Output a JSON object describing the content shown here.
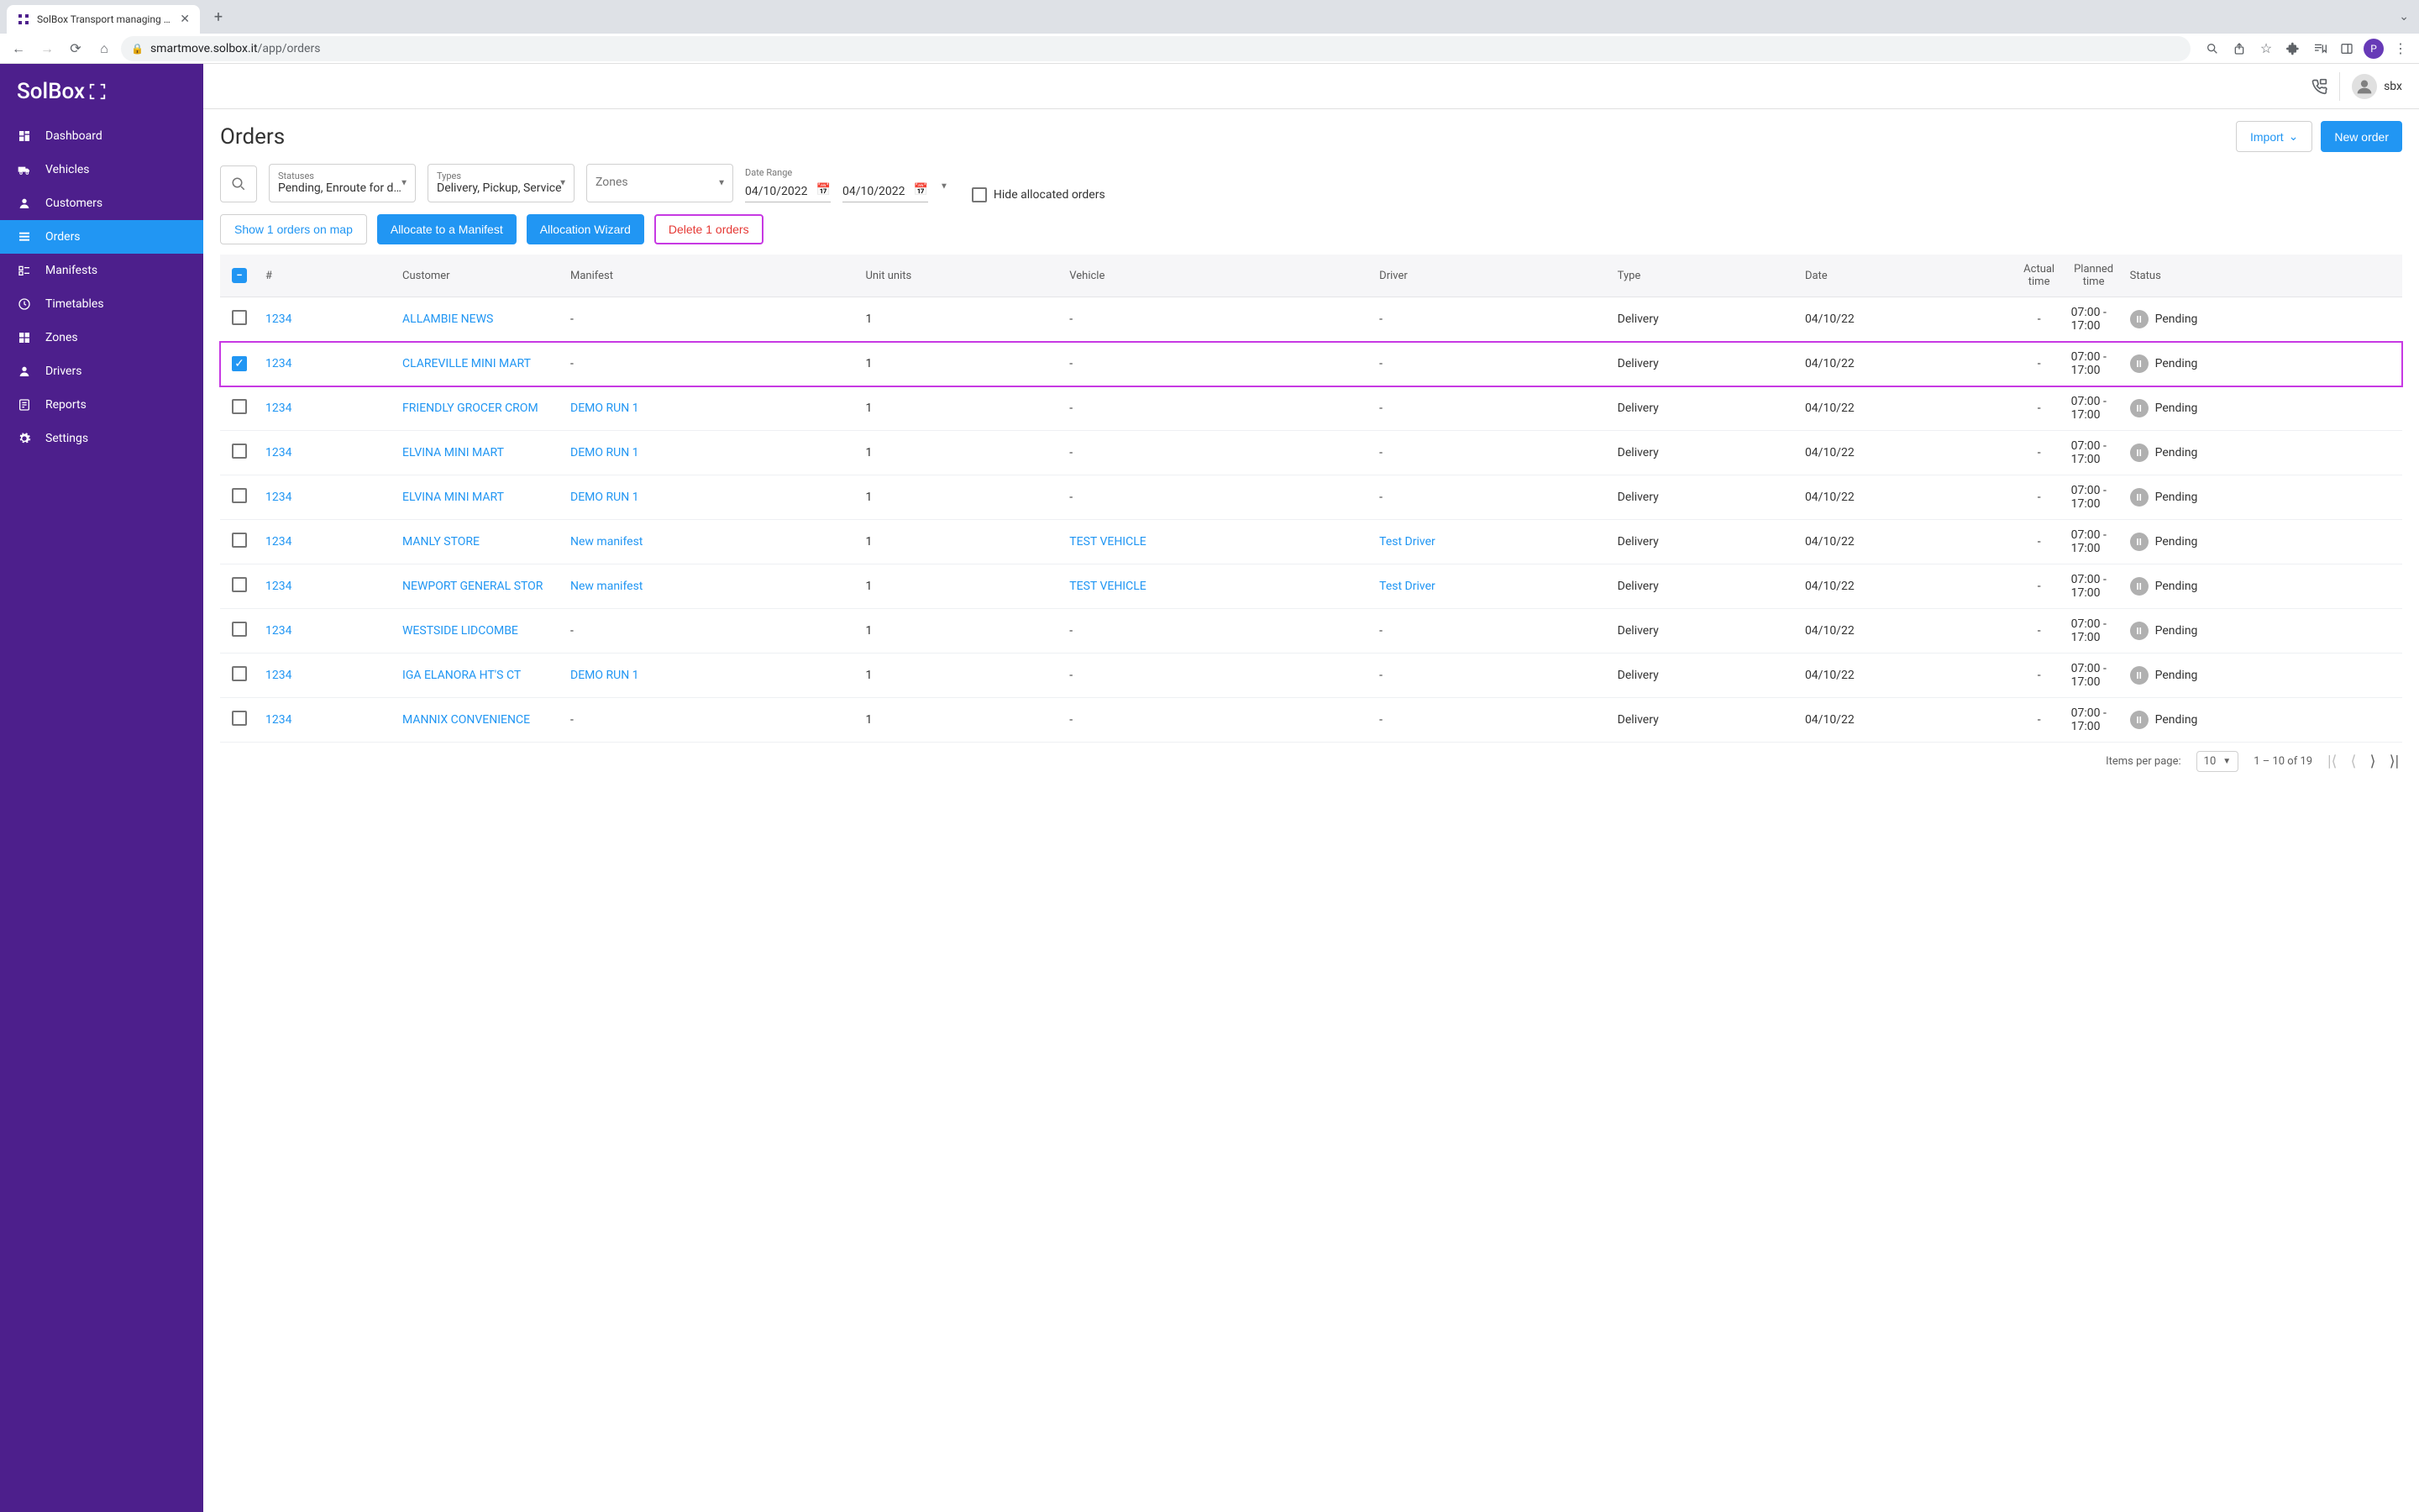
{
  "browser": {
    "tab_title": "SolBox Transport managing pl…",
    "url_host": "smartmove.solbox.it",
    "url_path": "/app/orders"
  },
  "app": {
    "logo": "SolBox",
    "username": "sbx"
  },
  "sidebar": {
    "items": [
      {
        "label": "Dashboard",
        "icon": "dashboard"
      },
      {
        "label": "Vehicles",
        "icon": "truck"
      },
      {
        "label": "Customers",
        "icon": "person"
      },
      {
        "label": "Orders",
        "icon": "list",
        "active": true
      },
      {
        "label": "Manifests",
        "icon": "manifest"
      },
      {
        "label": "Timetables",
        "icon": "clock"
      },
      {
        "label": "Zones",
        "icon": "zones"
      },
      {
        "label": "Drivers",
        "icon": "person"
      },
      {
        "label": "Reports",
        "icon": "report"
      },
      {
        "label": "Settings",
        "icon": "gear"
      }
    ]
  },
  "page": {
    "title": "Orders",
    "import_label": "Import",
    "new_order_label": "New order"
  },
  "filters": {
    "statuses_label": "Statuses",
    "statuses_value": "Pending, Enroute for del…",
    "types_label": "Types",
    "types_value": "Delivery, Pickup, Service",
    "zones_label": "Zones",
    "zones_value": "",
    "date_range_label": "Date Range",
    "date_from": "04/10/2022",
    "date_to": "04/10/2022",
    "hide_allocated_label": "Hide allocated orders"
  },
  "actions": {
    "show_on_map": "Show 1 orders on map",
    "allocate_manifest": "Allocate to a Manifest",
    "allocation_wizard": "Allocation Wizard",
    "delete_orders": "Delete 1 orders"
  },
  "table": {
    "headers": {
      "number": "#",
      "customer": "Customer",
      "manifest": "Manifest",
      "units": "Unit units",
      "vehicle": "Vehicle",
      "driver": "Driver",
      "type": "Type",
      "date": "Date",
      "actual_time": "Actual time",
      "planned_time": "Planned time",
      "status": "Status"
    },
    "rows": [
      {
        "checked": false,
        "num": "1234",
        "customer": "ALLAMBIE NEWS",
        "manifest": "-",
        "units": "1",
        "vehicle": "-",
        "driver": "-",
        "type": "Delivery",
        "date": "04/10/22",
        "actual": "-",
        "planned": "07:00 - 17:00",
        "status": "Pending",
        "highlighted": false
      },
      {
        "checked": true,
        "num": "1234",
        "customer": "CLAREVILLE MINI MART",
        "manifest": "-",
        "units": "1",
        "vehicle": "-",
        "driver": "-",
        "type": "Delivery",
        "date": "04/10/22",
        "actual": "-",
        "planned": "07:00 - 17:00",
        "status": "Pending",
        "highlighted": true
      },
      {
        "checked": false,
        "num": "1234",
        "customer": "FRIENDLY GROCER CROM",
        "manifest": "DEMO RUN 1",
        "units": "1",
        "vehicle": "-",
        "driver": "-",
        "type": "Delivery",
        "date": "04/10/22",
        "actual": "-",
        "planned": "07:00 - 17:00",
        "status": "Pending",
        "highlighted": false
      },
      {
        "checked": false,
        "num": "1234",
        "customer": "ELVINA MINI MART",
        "manifest": "DEMO RUN 1",
        "units": "1",
        "vehicle": "-",
        "driver": "-",
        "type": "Delivery",
        "date": "04/10/22",
        "actual": "-",
        "planned": "07:00 - 17:00",
        "status": "Pending",
        "highlighted": false
      },
      {
        "checked": false,
        "num": "1234",
        "customer": "ELVINA MINI MART",
        "manifest": "DEMO RUN 1",
        "units": "1",
        "vehicle": "-",
        "driver": "-",
        "type": "Delivery",
        "date": "04/10/22",
        "actual": "-",
        "planned": "07:00 - 17:00",
        "status": "Pending",
        "highlighted": false
      },
      {
        "checked": false,
        "num": "1234",
        "customer": "MANLY STORE",
        "manifest": "New manifest",
        "units": "1",
        "vehicle": "TEST VEHICLE",
        "driver": "Test Driver",
        "type": "Delivery",
        "date": "04/10/22",
        "actual": "-",
        "planned": "07:00 - 17:00",
        "status": "Pending",
        "highlighted": false
      },
      {
        "checked": false,
        "num": "1234",
        "customer": "NEWPORT GENERAL STOR",
        "manifest": "New manifest",
        "units": "1",
        "vehicle": "TEST VEHICLE",
        "driver": "Test Driver",
        "type": "Delivery",
        "date": "04/10/22",
        "actual": "-",
        "planned": "07:00 - 17:00",
        "status": "Pending",
        "highlighted": false
      },
      {
        "checked": false,
        "num": "1234",
        "customer": "WESTSIDE LIDCOMBE",
        "manifest": "-",
        "units": "1",
        "vehicle": "-",
        "driver": "-",
        "type": "Delivery",
        "date": "04/10/22",
        "actual": "-",
        "planned": "07:00 - 17:00",
        "status": "Pending",
        "highlighted": false
      },
      {
        "checked": false,
        "num": "1234",
        "customer": "IGA ELANORA HT'S CT",
        "manifest": "DEMO RUN 1",
        "units": "1",
        "vehicle": "-",
        "driver": "-",
        "type": "Delivery",
        "date": "04/10/22",
        "actual": "-",
        "planned": "07:00 - 17:00",
        "status": "Pending",
        "highlighted": false
      },
      {
        "checked": false,
        "num": "1234",
        "customer": "MANNIX CONVENIENCE",
        "manifest": "-",
        "units": "1",
        "vehicle": "-",
        "driver": "-",
        "type": "Delivery",
        "date": "04/10/22",
        "actual": "-",
        "planned": "07:00 - 17:00",
        "status": "Pending",
        "highlighted": false
      }
    ]
  },
  "paginator": {
    "items_per_page_label": "Items per page:",
    "items_per_page_value": "10",
    "range_text": "1 – 10 of 19"
  }
}
